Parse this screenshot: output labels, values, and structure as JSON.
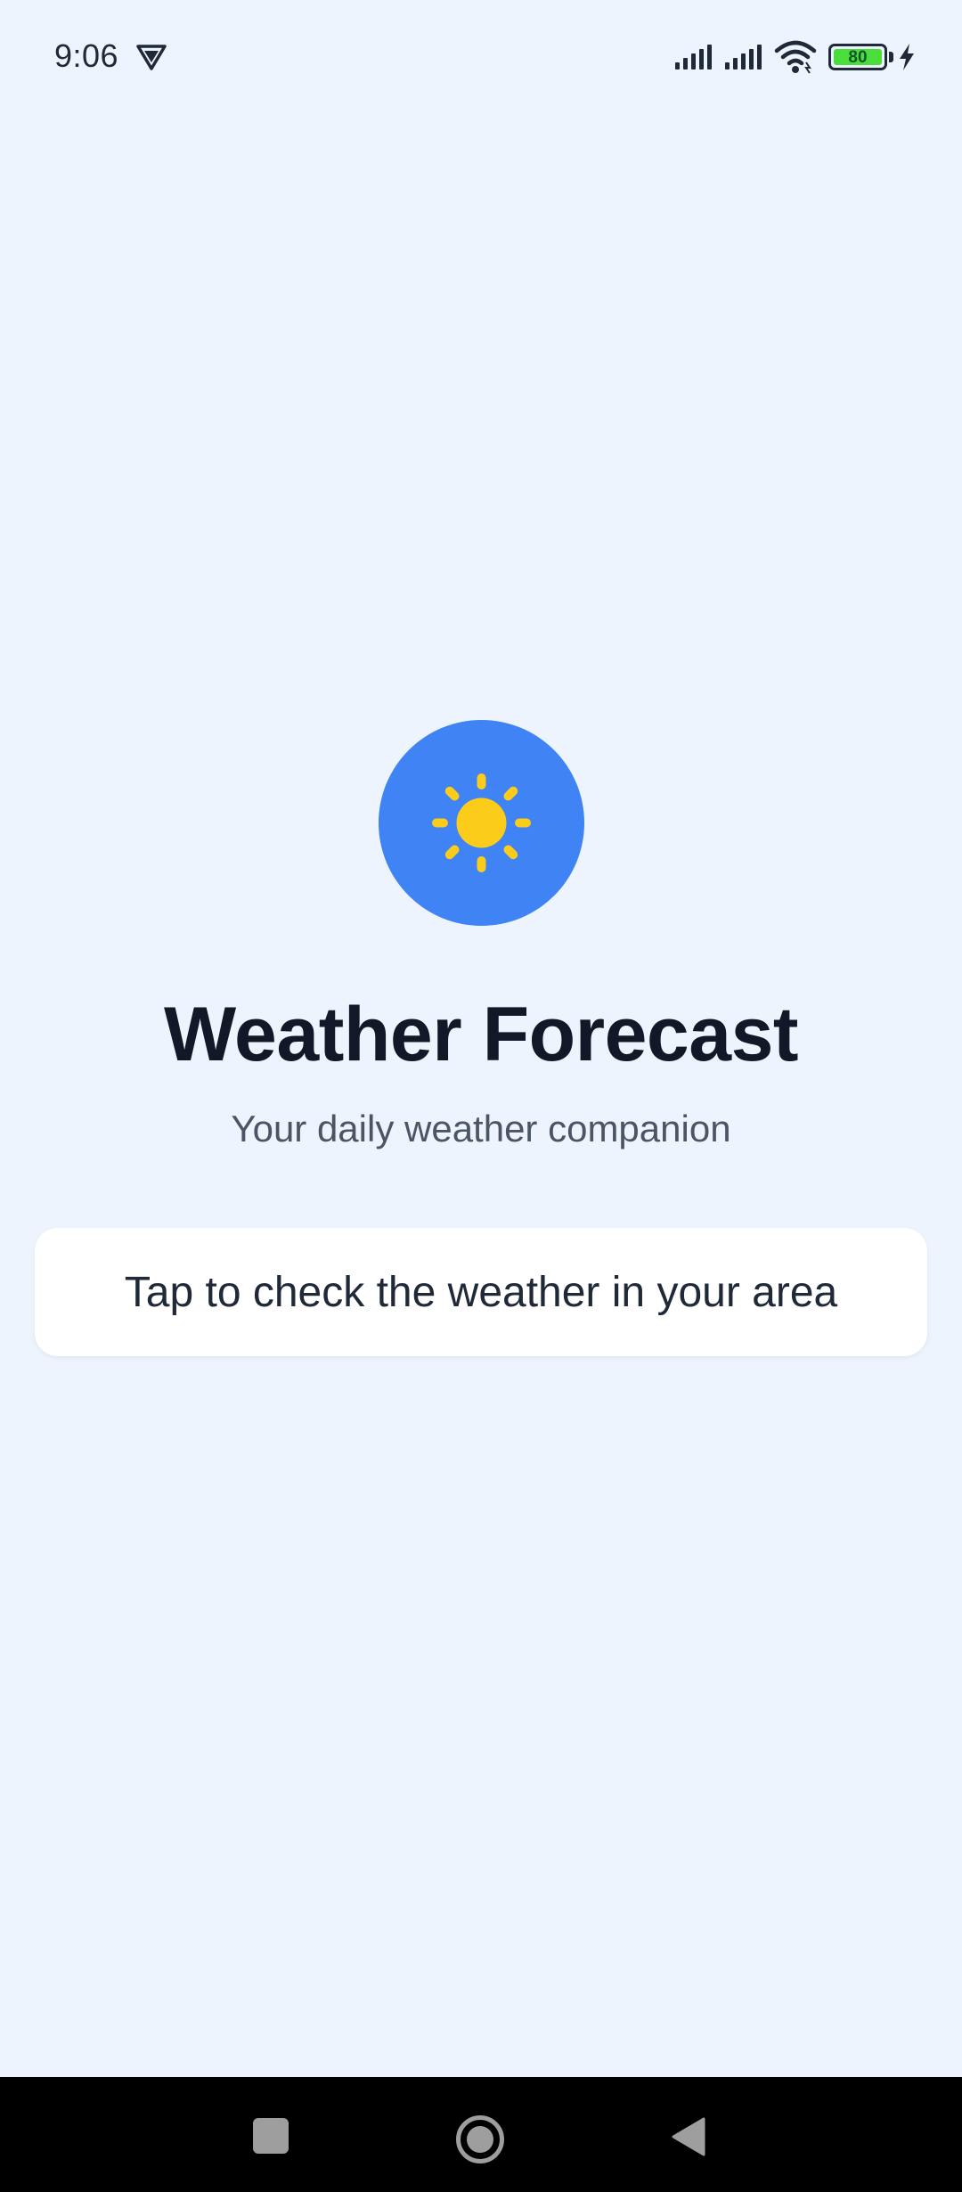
{
  "status_bar": {
    "time": "9:06",
    "battery_level": "80",
    "icons": [
      "vpn-shield-icon",
      "cell-signal-icon",
      "cell-signal-icon",
      "wifi-icon",
      "battery-icon",
      "charging-bolt-icon"
    ]
  },
  "main": {
    "logo_icon": "sun-icon",
    "title": "Weather Forecast",
    "subtitle": "Your daily weather companion",
    "action_label": "Tap to check the weather in your area"
  },
  "nav_bar": {
    "icons": [
      "recents-square-icon",
      "home-circle-icon",
      "back-triangle-icon"
    ]
  },
  "colors": {
    "background": "#edf4fe",
    "logo_circle": "#3f83f4",
    "sun": "#fccc1b",
    "title": "#111827",
    "subtitle": "#4b5563",
    "card": "#ffffff",
    "battery": "#4ade3a"
  }
}
